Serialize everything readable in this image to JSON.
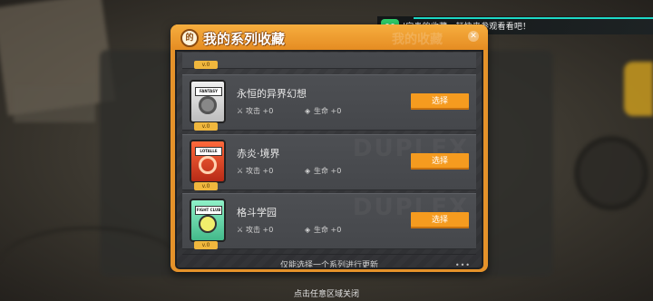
{
  "notification": {
    "text": "|宝贵的收藏，赶快来参观看看吧！"
  },
  "panel": {
    "title": "我的系列收藏",
    "logo_text": "的",
    "watermark": "我的收藏",
    "close_icon": "close-icon",
    "colors": {
      "header": "#e5922a",
      "button": "#f59b1f",
      "body": "#35363a"
    }
  },
  "series": [
    {
      "name": "",
      "version": "v.0",
      "card_tag": "",
      "partial": true
    },
    {
      "name": "永恒的异界幻想",
      "version": "v.0",
      "card_tag": "FANTASY",
      "attack": "攻击 +0",
      "health": "生命 +0",
      "button": "选择",
      "card_icon": "fantasy-card-icon",
      "watermark": ""
    },
    {
      "name": "赤炎·境界",
      "version": "v.0",
      "card_tag": "LOTALLE",
      "attack": "攻击 +0",
      "health": "生命 +0",
      "button": "选择",
      "card_icon": "fire-card-icon",
      "watermark": "DUPLEX"
    },
    {
      "name": "格斗学园",
      "version": "v.0",
      "card_tag": "FIGHT CLUB",
      "attack": "攻击 +0",
      "health": "生命 +0",
      "button": "选择",
      "card_icon": "fight-card-icon",
      "watermark": "DUPLEX"
    }
  ],
  "footer_hint": "仅能选择一个系列进行更新",
  "bottom_hint": "点击任意区域关闭"
}
